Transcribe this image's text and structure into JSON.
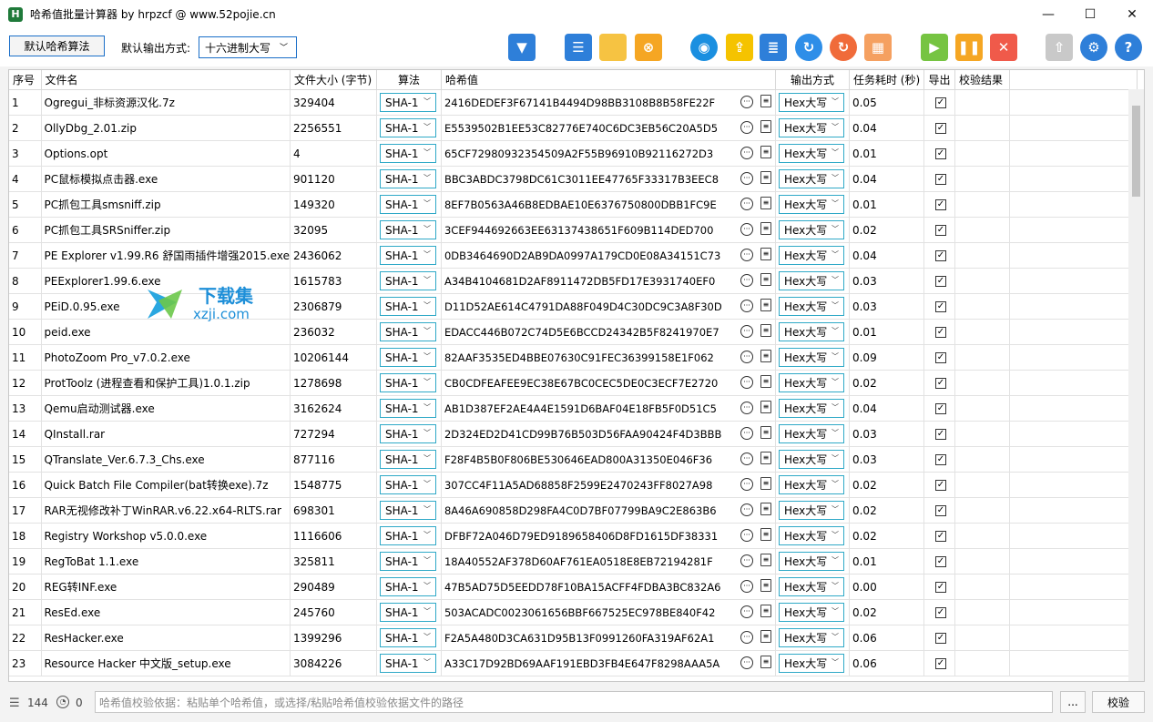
{
  "window": {
    "title": "哈希值批量计算器 by hrpzcf @ www.52pojie.cn",
    "app_icon": "H",
    "minimize": "—",
    "maximize": "☐",
    "close": "✕"
  },
  "toolbar": {
    "default_algo_button": "默认哈希算法",
    "output_label": "默认输出方式:",
    "output_value": "十六进制大写",
    "buttons": [
      {
        "name": "filter-icon",
        "color": "#2e7fd9",
        "glyph": "▼"
      },
      {
        "name": "list-icon",
        "color": "#2e7fd9",
        "glyph": "☰"
      },
      {
        "name": "folder-icon",
        "color": "#f6c342",
        "glyph": ""
      },
      {
        "name": "clear-search-icon",
        "color": "#f5a623",
        "glyph": "⊗"
      },
      {
        "name": "eye-icon",
        "color": "#1a8fe0",
        "glyph": "◉"
      },
      {
        "name": "export-icon",
        "color": "#f5c300",
        "glyph": "⇪"
      },
      {
        "name": "details-icon",
        "color": "#2e7fd9",
        "glyph": "≣"
      },
      {
        "name": "refresh-icon",
        "color": "#2e8ee8",
        "glyph": "↻"
      },
      {
        "name": "reset-icon",
        "color": "#f06b3a",
        "glyph": "↻"
      },
      {
        "name": "clean-icon",
        "color": "#f5a060",
        "glyph": "▦"
      },
      {
        "name": "start-icon",
        "color": "#76c442",
        "glyph": "▶"
      },
      {
        "name": "pause-icon",
        "color": "#f5a623",
        "glyph": "❚❚"
      },
      {
        "name": "stop-icon",
        "color": "#f05a4a",
        "glyph": "✕"
      },
      {
        "name": "top-icon",
        "color": "#c9c9c9",
        "glyph": "⇧"
      },
      {
        "name": "settings-icon",
        "color": "#2e7fd9",
        "glyph": "⚙"
      },
      {
        "name": "help-icon",
        "color": "#2e7fd9",
        "glyph": "?"
      }
    ]
  },
  "table": {
    "headers": [
      "序号",
      "文件名",
      "文件大小 (字节)",
      "算法",
      "哈希值",
      "输出方式",
      "任务耗时 (秒)",
      "导出",
      "校验结果"
    ],
    "rows": [
      {
        "idx": "1",
        "name": "Ogregui_非标资源汉化.7z",
        "size": "329404",
        "algo": "SHA-1",
        "hash": "2416DEDEF3F67141B4494D98BB3108B8B58FE22F",
        "fmt": "Hex大写",
        "time": "0.05"
      },
      {
        "idx": "2",
        "name": "OllyDbg_2.01.zip",
        "size": "2256551",
        "algo": "SHA-1",
        "hash": "E5539502B1EE53C82776E740C6DC3EB56C20A5D5",
        "fmt": "Hex大写",
        "time": "0.04"
      },
      {
        "idx": "3",
        "name": "Options.opt",
        "size": "4",
        "algo": "SHA-1",
        "hash": "65CF72980932354509A2F55B96910B92116272D3",
        "fmt": "Hex大写",
        "time": "0.01"
      },
      {
        "idx": "4",
        "name": "PC鼠标模拟点击器.exe",
        "size": "901120",
        "algo": "SHA-1",
        "hash": "BBC3ABDC3798DC61C3011EE47765F33317B3EEC8",
        "fmt": "Hex大写",
        "time": "0.04"
      },
      {
        "idx": "5",
        "name": "PC抓包工具smsniff.zip",
        "size": "149320",
        "algo": "SHA-1",
        "hash": "8EF7B0563A46B8EDBAE10E6376750800DBB1FC9E",
        "fmt": "Hex大写",
        "time": "0.01"
      },
      {
        "idx": "6",
        "name": "PC抓包工具SRSniffer.zip",
        "size": "32095",
        "algo": "SHA-1",
        "hash": "3CEF944692663EE63137438651F609B114DED700",
        "fmt": "Hex大写",
        "time": "0.02"
      },
      {
        "idx": "7",
        "name": "PE Explorer v1.99.R6 舒国雨插件增强2015.exe",
        "size": "2436062",
        "algo": "SHA-1",
        "hash": "0DB3464690D2AB9DA0997A179CD0E08A34151C73",
        "fmt": "Hex大写",
        "time": "0.04"
      },
      {
        "idx": "8",
        "name": "PEExplorer1.99.6.exe",
        "size": "1615783",
        "algo": "SHA-1",
        "hash": "A34B4104681D2AF8911472DB5FD17E3931740EF0",
        "fmt": "Hex大写",
        "time": "0.03"
      },
      {
        "idx": "9",
        "name": "PEiD.0.95.exe",
        "size": "2306879",
        "algo": "SHA-1",
        "hash": "D11D52AE614C4791DA88F049D4C30DC9C3A8F30D",
        "fmt": "Hex大写",
        "time": "0.03"
      },
      {
        "idx": "10",
        "name": "peid.exe",
        "size": "236032",
        "algo": "SHA-1",
        "hash": "EDACC446B072C74D5E6BCCD24342B5F8241970E7",
        "fmt": "Hex大写",
        "time": "0.01"
      },
      {
        "idx": "11",
        "name": "PhotoZoom Pro_v7.0.2.exe",
        "size": "10206144",
        "algo": "SHA-1",
        "hash": "82AAF3535ED4BBE07630C91FEC36399158E1F062",
        "fmt": "Hex大写",
        "time": "0.09"
      },
      {
        "idx": "12",
        "name": "ProtToolz (进程查看和保护工具)1.0.1.zip",
        "size": "1278698",
        "algo": "SHA-1",
        "hash": "CB0CDFEAFEE9EC38E67BC0CEC5DE0C3ECF7E2720",
        "fmt": "Hex大写",
        "time": "0.02"
      },
      {
        "idx": "13",
        "name": "Qemu启动测试器.exe",
        "size": "3162624",
        "algo": "SHA-1",
        "hash": "AB1D387EF2AE4A4E1591D6BAF04E18FB5F0D51C5",
        "fmt": "Hex大写",
        "time": "0.04"
      },
      {
        "idx": "14",
        "name": "QInstall.rar",
        "size": "727294",
        "algo": "SHA-1",
        "hash": "2D324ED2D41CD99B76B503D56FAA90424F4D3BBB",
        "fmt": "Hex大写",
        "time": "0.03"
      },
      {
        "idx": "15",
        "name": "QTranslate_Ver.6.7.3_Chs.exe",
        "size": "877116",
        "algo": "SHA-1",
        "hash": "F28F4B5B0F806BE530646EAD800A31350E046F36",
        "fmt": "Hex大写",
        "time": "0.03"
      },
      {
        "idx": "16",
        "name": "Quick Batch File Compiler(bat转换exe).7z",
        "size": "1548775",
        "algo": "SHA-1",
        "hash": "307CC4F11A5AD68858F2599E2470243FF8027A98",
        "fmt": "Hex大写",
        "time": "0.02"
      },
      {
        "idx": "17",
        "name": "RAR无视修改补丁WinRAR.v6.22.x64-RLTS.rar",
        "size": "698301",
        "algo": "SHA-1",
        "hash": "8A46A690858D298FA4C0D7BF07799BA9C2E863B6",
        "fmt": "Hex大写",
        "time": "0.02"
      },
      {
        "idx": "18",
        "name": "Registry Workshop v5.0.0.exe",
        "size": "1116606",
        "algo": "SHA-1",
        "hash": "DFBF72A046D79ED9189658406D8FD1615DF38331",
        "fmt": "Hex大写",
        "time": "0.02"
      },
      {
        "idx": "19",
        "name": "RegToBat 1.1.exe",
        "size": "325811",
        "algo": "SHA-1",
        "hash": "18A40552AF378D60AF761EA0518E8EB72194281F",
        "fmt": "Hex大写",
        "time": "0.01"
      },
      {
        "idx": "20",
        "name": "REG转INF.exe",
        "size": "290489",
        "algo": "SHA-1",
        "hash": "47B5AD75D5EEDD78F10BA15ACFF4FDBA3BC832A6",
        "fmt": "Hex大写",
        "time": "0.00"
      },
      {
        "idx": "21",
        "name": "ResEd.exe",
        "size": "245760",
        "algo": "SHA-1",
        "hash": "503ACADC0023061656BBF667525EC978BE840F42",
        "fmt": "Hex大写",
        "time": "0.02"
      },
      {
        "idx": "22",
        "name": "ResHacker.exe",
        "size": "1399296",
        "algo": "SHA-1",
        "hash": "F2A5A480D3CA631D95B13F0991260FA319AF62A1",
        "fmt": "Hex大写",
        "time": "0.06"
      },
      {
        "idx": "23",
        "name": "Resource Hacker 中文版_setup.exe",
        "size": "3084226",
        "algo": "SHA-1",
        "hash": "A33C17D92BD69AAF191EBD3FB4E647F8298AAA5A",
        "fmt": "Hex大写",
        "time": "0.06"
      }
    ]
  },
  "watermark": {
    "line1": "下载集",
    "line2": "xzji.com"
  },
  "status": {
    "file_count": "144",
    "running_count": "0",
    "verify_placeholder": "哈希值校验依据：粘贴单个哈希值，或选择/粘贴哈希值校验依据文件的路径",
    "browse_label": "...",
    "verify_label": "校验"
  }
}
